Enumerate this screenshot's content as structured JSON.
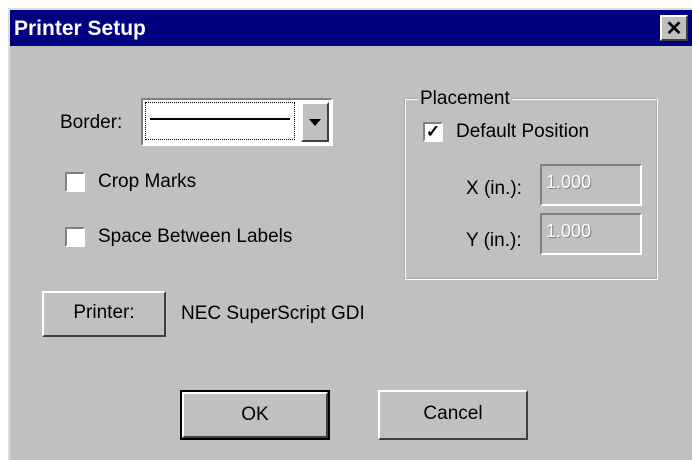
{
  "dialog": {
    "title": "Printer Setup",
    "close_glyph": "✕",
    "border_label": "Border:",
    "crop_marks_label": "Crop Marks",
    "crop_marks_checked": false,
    "space_between_label": "Space Between Labels",
    "space_between_checked": false,
    "placement": {
      "legend": "Placement",
      "default_position_label": "Default Position",
      "default_position_checked": true,
      "check_glyph": "✓",
      "x_label": "X (in.):",
      "x_value": "1.000",
      "y_label": "Y (in.):",
      "y_value": "1.000"
    },
    "printer_button": "Printer:",
    "printer_name": "NEC SuperScript GDI",
    "ok_button": "OK",
    "cancel_button": "Cancel"
  },
  "colors": {
    "title_bar": "#000080",
    "face": "#c0c0c0"
  }
}
